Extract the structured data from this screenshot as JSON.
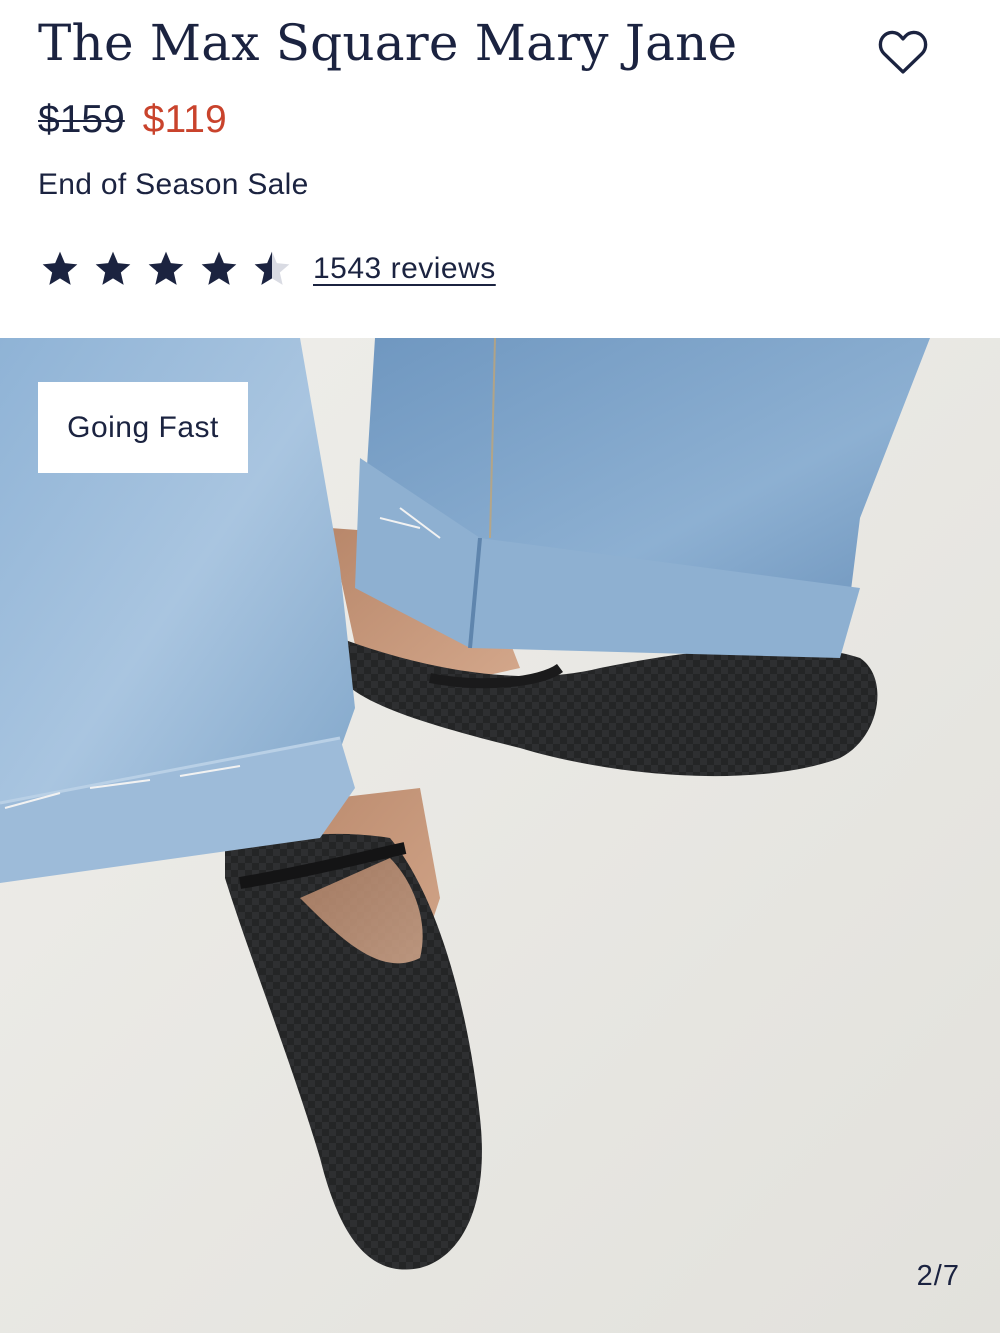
{
  "product": {
    "title": "The Max Square Mary Jane",
    "price_original": "$159",
    "price_sale": "$119",
    "promo": "End of Season Sale"
  },
  "rating": {
    "stars": 4.5,
    "reviews_label": "1543 reviews"
  },
  "gallery": {
    "badge": "Going Fast",
    "counter": "2/7",
    "image_subject": "Feet in black knit square-toe Mary Jane flats with cuffed light-wash jeans"
  },
  "icons": {
    "favorite": "heart-outline-icon",
    "star": "star-icon"
  },
  "colors": {
    "navy": "#1b2340",
    "sale_red": "#c9432c",
    "background": "#ffffff",
    "photo_floor": "#e9e8e3"
  }
}
